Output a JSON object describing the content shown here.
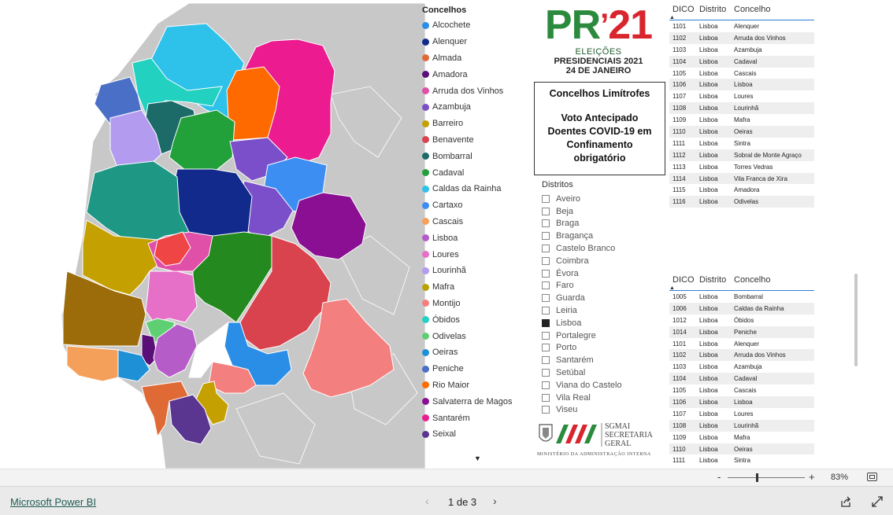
{
  "legend": {
    "title": "Concelhos",
    "items": [
      {
        "label": "Alcochete",
        "color": "#2b8ee6"
      },
      {
        "label": "Alenquer",
        "color": "#112a8c"
      },
      {
        "label": "Almada",
        "color": "#e06a35"
      },
      {
        "label": "Amadora",
        "color": "#5a0f78"
      },
      {
        "label": "Arruda dos Vinhos",
        "color": "#e04fa8"
      },
      {
        "label": "Azambuja",
        "color": "#7a4fc9"
      },
      {
        "label": "Barreiro",
        "color": "#c4a000"
      },
      {
        "label": "Benavente",
        "color": "#d9434d"
      },
      {
        "label": "Bombarral",
        "color": "#1c6b68"
      },
      {
        "label": "Cadaval",
        "color": "#22a03a"
      },
      {
        "label": "Caldas da Rainha",
        "color": "#2ec1ea"
      },
      {
        "label": "Cartaxo",
        "color": "#3d8ef2"
      },
      {
        "label": "Cascais",
        "color": "#f5a05a"
      },
      {
        "label": "Lisboa",
        "color": "#b65cc9"
      },
      {
        "label": "Loures",
        "color": "#e66fc8"
      },
      {
        "label": "Lourinhã",
        "color": "#b39bf0"
      },
      {
        "label": "Mafra",
        "color": "#b8a200"
      },
      {
        "label": "Montijo",
        "color": "#f47f7f"
      },
      {
        "label": "Óbidos",
        "color": "#22d1c0"
      },
      {
        "label": "Odivelas",
        "color": "#5fcf73"
      },
      {
        "label": "Oeiras",
        "color": "#1e90d6"
      },
      {
        "label": "Peniche",
        "color": "#4a6fc7"
      },
      {
        "label": "Rio Maior",
        "color": "#ff6a00"
      },
      {
        "label": "Salvaterra de Magos",
        "color": "#8a0f92"
      },
      {
        "label": "Santarém",
        "color": "#ec1b8f"
      },
      {
        "label": "Seixal",
        "color": "#5a3690"
      }
    ]
  },
  "logo": {
    "pr": "PR",
    "apos": "’",
    "year": "21",
    "line1": "ELEIÇÕES",
    "line2": "PRESIDENCIAIS 2021",
    "line3": "24 DE JANEIRO"
  },
  "infobox": {
    "title": "Concelhos Limítrofes",
    "lines": [
      "Voto Antecipado",
      "Doentes COVID-19 em",
      "Confinamento",
      "obrigatório"
    ]
  },
  "slicer": {
    "title": "Distritos",
    "options": [
      {
        "label": "Aveiro",
        "checked": false
      },
      {
        "label": "Beja",
        "checked": false
      },
      {
        "label": "Braga",
        "checked": false
      },
      {
        "label": "Bragança",
        "checked": false
      },
      {
        "label": "Castelo Branco",
        "checked": false
      },
      {
        "label": "Coimbra",
        "checked": false
      },
      {
        "label": "Évora",
        "checked": false
      },
      {
        "label": "Faro",
        "checked": false
      },
      {
        "label": "Guarda",
        "checked": false
      },
      {
        "label": "Leiria",
        "checked": false
      },
      {
        "label": "Lisboa",
        "checked": true
      },
      {
        "label": "Portalegre",
        "checked": false
      },
      {
        "label": "Porto",
        "checked": false
      },
      {
        "label": "Santarém",
        "checked": false
      },
      {
        "label": "Setúbal",
        "checked": false
      },
      {
        "label": "Viana do Castelo",
        "checked": false
      },
      {
        "label": "Vila Real",
        "checked": false
      },
      {
        "label": "Viseu",
        "checked": false
      }
    ]
  },
  "sgmai": {
    "line1": "SGMAI",
    "line2": "SECRETARIA",
    "line3": "GERAL",
    "ministry": "MINISTÉRIO DA ADMINISTRAÇÃO INTERNA"
  },
  "table1": {
    "headers": [
      "DICO",
      "Distrito",
      "Concelho"
    ],
    "rows": [
      [
        "1101",
        "Lisboa",
        "Alenquer"
      ],
      [
        "1102",
        "Lisboa",
        "Arruda dos Vinhos"
      ],
      [
        "1103",
        "Lisboa",
        "Azambuja"
      ],
      [
        "1104",
        "Lisboa",
        "Cadaval"
      ],
      [
        "1105",
        "Lisboa",
        "Cascais"
      ],
      [
        "1106",
        "Lisboa",
        "Lisboa"
      ],
      [
        "1107",
        "Lisboa",
        "Loures"
      ],
      [
        "1108",
        "Lisboa",
        "Lourinhã"
      ],
      [
        "1109",
        "Lisboa",
        "Mafra"
      ],
      [
        "1110",
        "Lisboa",
        "Oeiras"
      ],
      [
        "1111",
        "Lisboa",
        "Sintra"
      ],
      [
        "1112",
        "Lisboa",
        "Sobral de Monte Agraço"
      ],
      [
        "1113",
        "Lisboa",
        "Torres Vedras"
      ],
      [
        "1114",
        "Lisboa",
        "Vila Franca de Xira"
      ],
      [
        "1115",
        "Lisboa",
        "Amadora"
      ],
      [
        "1116",
        "Lisboa",
        "Odivelas"
      ]
    ]
  },
  "table2": {
    "headers": [
      "DICO",
      "Distrito",
      "Concelho"
    ],
    "rows": [
      [
        "1005",
        "Lisboa",
        "Bombarral"
      ],
      [
        "1006",
        "Lisboa",
        "Caldas da Rainha"
      ],
      [
        "1012",
        "Lisboa",
        "Óbidos"
      ],
      [
        "1014",
        "Lisboa",
        "Peniche"
      ],
      [
        "1101",
        "Lisboa",
        "Alenquer"
      ],
      [
        "1102",
        "Lisboa",
        "Arruda dos Vinhos"
      ],
      [
        "1103",
        "Lisboa",
        "Azambuja"
      ],
      [
        "1104",
        "Lisboa",
        "Cadaval"
      ],
      [
        "1105",
        "Lisboa",
        "Cascais"
      ],
      [
        "1106",
        "Lisboa",
        "Lisboa"
      ],
      [
        "1107",
        "Lisboa",
        "Loures"
      ],
      [
        "1108",
        "Lisboa",
        "Lourinhã"
      ],
      [
        "1109",
        "Lisboa",
        "Mafra"
      ],
      [
        "1110",
        "Lisboa",
        "Oeiras"
      ],
      [
        "1111",
        "Lisboa",
        "Sintra"
      ]
    ]
  },
  "zoom": {
    "minus": "-",
    "plus": "+",
    "percent": "83%",
    "level": 0.38
  },
  "footer": {
    "brand": "Microsoft Power BI",
    "page": "1 de 3",
    "prev": "‹",
    "next": "›"
  }
}
